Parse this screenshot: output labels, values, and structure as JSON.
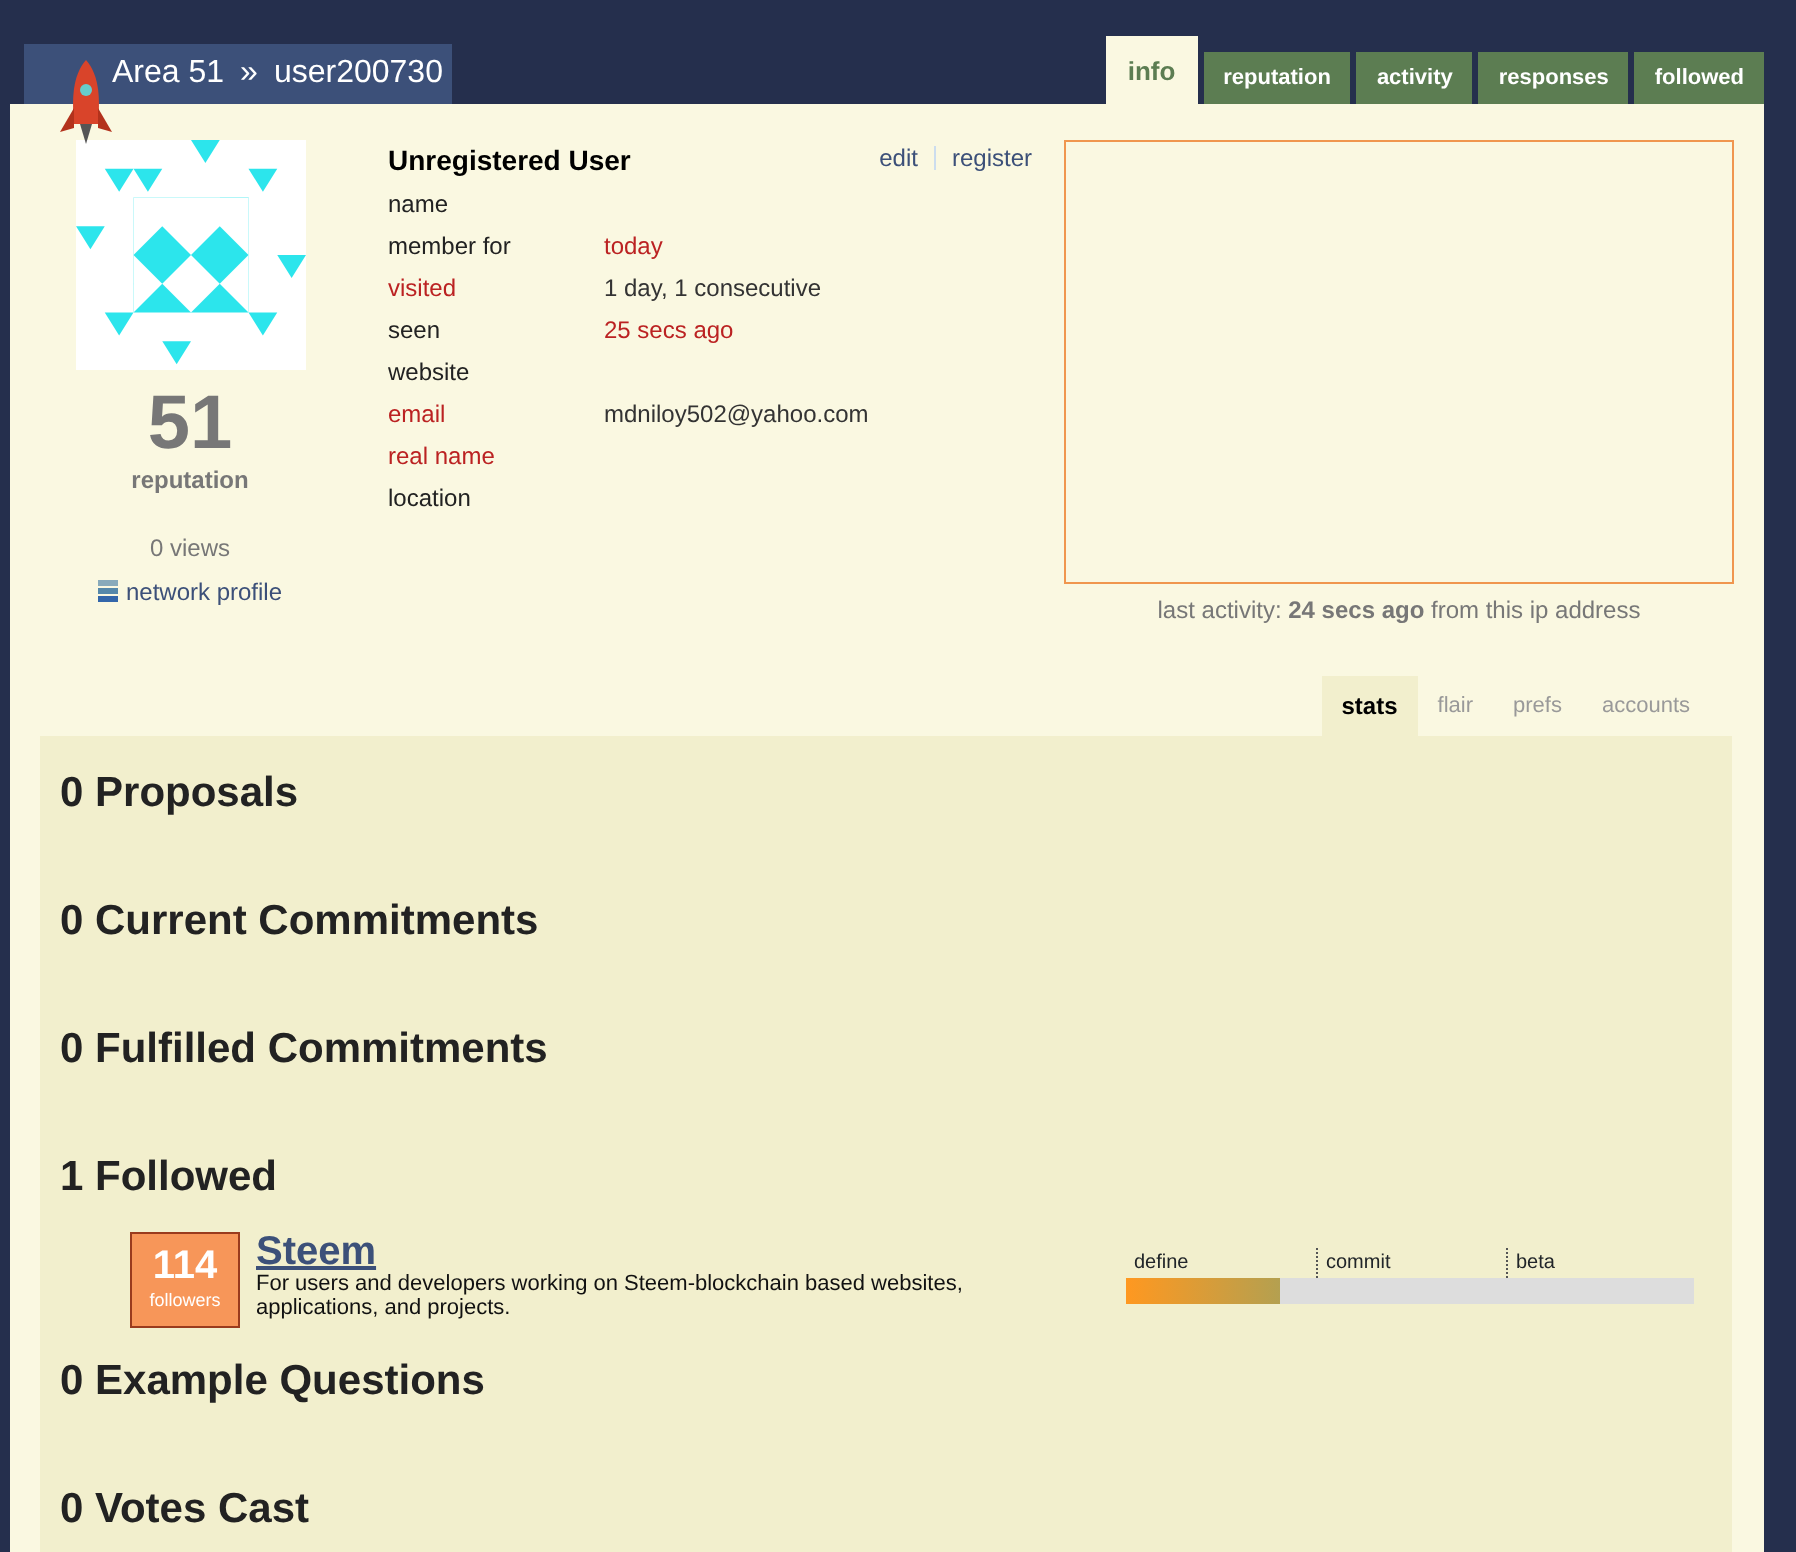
{
  "header": {
    "site": "Area 51",
    "separator": "»",
    "user": "user200730"
  },
  "tabs": [
    {
      "label": "info",
      "selected": true
    },
    {
      "label": "reputation",
      "selected": false
    },
    {
      "label": "activity",
      "selected": false
    },
    {
      "label": "responses",
      "selected": false
    },
    {
      "label": "followed",
      "selected": false
    }
  ],
  "profile": {
    "reputation": "51",
    "reputation_label": "reputation",
    "views": "0 views",
    "network_link": "network profile",
    "display_name": "Unregistered User",
    "actions": [
      "edit",
      "register"
    ],
    "fields": [
      {
        "label": "name",
        "highlighted": false
      },
      {
        "label": "member for",
        "highlighted": false,
        "value": "today",
        "value_highlighted": true
      },
      {
        "label": "visited",
        "highlighted": true,
        "value": "1 day, 1 consecutive",
        "value_highlighted": false
      },
      {
        "label": "seen",
        "highlighted": false,
        "value": "25 secs ago",
        "value_highlighted": true
      },
      {
        "label": "website",
        "highlighted": false
      },
      {
        "label": "email",
        "highlighted": true,
        "value": "mdniloy502@yahoo.com",
        "value_highlighted": false
      },
      {
        "label": "real name",
        "highlighted": true
      },
      {
        "label": "location",
        "highlighted": false
      }
    ],
    "last_activity": {
      "prefix": "last activity: ",
      "time": "24 secs ago",
      "suffix": " from this ip address"
    }
  },
  "subtabs": [
    {
      "label": "stats",
      "selected": true
    },
    {
      "label": "flair",
      "selected": false
    },
    {
      "label": "prefs",
      "selected": false
    },
    {
      "label": "accounts",
      "selected": false
    }
  ],
  "sections": [
    {
      "title": "0 Proposals"
    },
    {
      "title": "0 Current Commitments"
    },
    {
      "title": "0 Fulfilled Commitments"
    },
    {
      "title": "1 Followed",
      "items": [
        {
          "followers": "114",
          "followers_label": "followers",
          "name": "Steem",
          "description": "For users and developers working on Steem-blockchain based websites, applications, and projects.",
          "stages": [
            "define",
            "commit",
            "beta"
          ],
          "level": 0.27
        }
      ]
    },
    {
      "title": "0 Example Questions"
    },
    {
      "title": "0 Votes Cast"
    }
  ]
}
